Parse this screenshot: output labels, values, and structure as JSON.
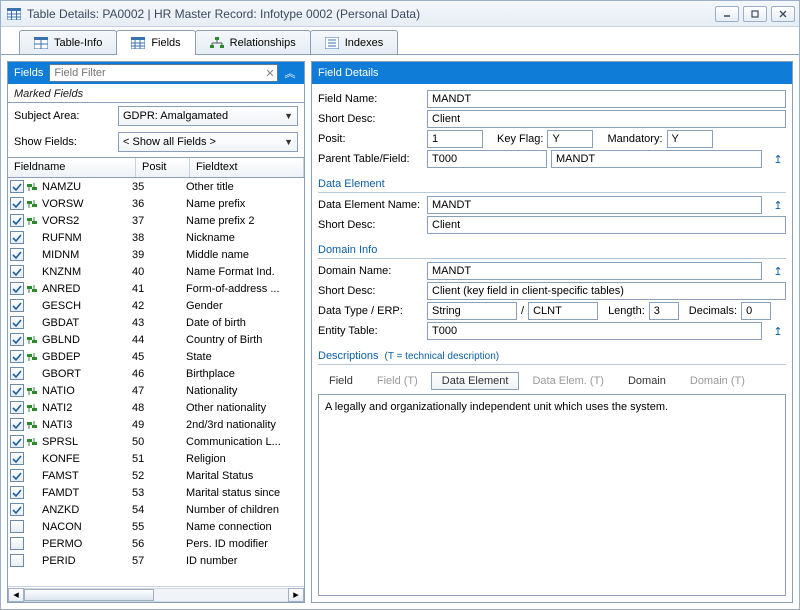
{
  "window": {
    "title": "Table Details: PA0002 | HR Master Record: Infotype 0002 (Personal Data)"
  },
  "tabs": [
    {
      "label": "Table-Info"
    },
    {
      "label": "Fields"
    },
    {
      "label": "Relationships"
    },
    {
      "label": "Indexes"
    }
  ],
  "left": {
    "header_label": "Fields",
    "filter_placeholder": "Field Filter",
    "marked_fields_label": "Marked Fields",
    "subject_area_label": "Subject Area:",
    "subject_area_value": "GDPR: Amalgamated",
    "show_fields_label": "Show Fields:",
    "show_fields_value": "< Show all Fields >",
    "columns": {
      "fieldname": "Fieldname",
      "posit": "Posit",
      "fieldtext": "Fieldtext"
    },
    "rows": [
      {
        "c": true,
        "m": true,
        "fn": "NAMZU",
        "ps": "35",
        "ft": "Other title"
      },
      {
        "c": true,
        "m": true,
        "fn": "VORSW",
        "ps": "36",
        "ft": "Name prefix"
      },
      {
        "c": true,
        "m": true,
        "fn": "VORS2",
        "ps": "37",
        "ft": "Name prefix 2"
      },
      {
        "c": true,
        "m": false,
        "fn": "RUFNM",
        "ps": "38",
        "ft": "Nickname"
      },
      {
        "c": true,
        "m": false,
        "fn": "MIDNM",
        "ps": "39",
        "ft": "Middle name"
      },
      {
        "c": true,
        "m": false,
        "fn": "KNZNM",
        "ps": "40",
        "ft": "Name Format Ind."
      },
      {
        "c": true,
        "m": true,
        "fn": "ANRED",
        "ps": "41",
        "ft": "Form-of-address ..."
      },
      {
        "c": true,
        "m": false,
        "fn": "GESCH",
        "ps": "42",
        "ft": "Gender"
      },
      {
        "c": true,
        "m": false,
        "fn": "GBDAT",
        "ps": "43",
        "ft": "Date of birth"
      },
      {
        "c": true,
        "m": true,
        "fn": "GBLND",
        "ps": "44",
        "ft": "Country of Birth"
      },
      {
        "c": true,
        "m": true,
        "fn": "GBDEP",
        "ps": "45",
        "ft": "State"
      },
      {
        "c": true,
        "m": false,
        "fn": "GBORT",
        "ps": "46",
        "ft": "Birthplace"
      },
      {
        "c": true,
        "m": true,
        "fn": "NATIO",
        "ps": "47",
        "ft": "Nationality"
      },
      {
        "c": true,
        "m": true,
        "fn": "NATI2",
        "ps": "48",
        "ft": "Other nationality"
      },
      {
        "c": true,
        "m": true,
        "fn": "NATI3",
        "ps": "49",
        "ft": "2nd/3rd nationality"
      },
      {
        "c": true,
        "m": true,
        "fn": "SPRSL",
        "ps": "50",
        "ft": "Communication L..."
      },
      {
        "c": true,
        "m": false,
        "fn": "KONFE",
        "ps": "51",
        "ft": "Religion"
      },
      {
        "c": true,
        "m": false,
        "fn": "FAMST",
        "ps": "52",
        "ft": "Marital Status"
      },
      {
        "c": true,
        "m": false,
        "fn": "FAMDT",
        "ps": "53",
        "ft": "Marital status since"
      },
      {
        "c": true,
        "m": false,
        "fn": "ANZKD",
        "ps": "54",
        "ft": "Number of children"
      },
      {
        "c": false,
        "m": false,
        "fn": "NACON",
        "ps": "55",
        "ft": "Name connection"
      },
      {
        "c": false,
        "m": false,
        "fn": "PERMO",
        "ps": "56",
        "ft": "Pers. ID modifier"
      },
      {
        "c": false,
        "m": false,
        "fn": "PERID",
        "ps": "57",
        "ft": "ID number"
      }
    ]
  },
  "right": {
    "header": "Field Details",
    "field_name_label": "Field Name:",
    "field_name": "MANDT",
    "short_desc_label": "Short Desc:",
    "short_desc": "Client",
    "posit_label": "Posit:",
    "posit": "1",
    "key_flag_label": "Key Flag:",
    "key_flag": "Y",
    "mandatory_label": "Mandatory:",
    "mandatory": "Y",
    "parent_label": "Parent Table/Field:",
    "parent_table": "T000",
    "parent_field": "MANDT",
    "de_legend": "Data Element",
    "de_name_label": "Data Element Name:",
    "de_name": "MANDT",
    "de_short_label": "Short Desc:",
    "de_short": "Client",
    "dom_legend": "Domain Info",
    "dom_name_label": "Domain Name:",
    "dom_name": "MANDT",
    "dom_short_label": "Short Desc:",
    "dom_short": "Client (key field in client-specific tables)",
    "dtype_label": "Data Type / ERP:",
    "dtype": "String",
    "slash": "/",
    "erp": "CLNT",
    "length_label": "Length:",
    "length": "3",
    "decimals_label": "Decimals:",
    "decimals": "0",
    "entity_label": "Entity Table:",
    "entity": "T000",
    "desc_legend": "Descriptions",
    "desc_sub": "(T = technical description)",
    "desc_tabs": [
      "Field",
      "Field (T)",
      "Data Element",
      "Data Elem. (T)",
      "Domain",
      "Domain (T)"
    ],
    "desc_text": "A legally and organizationally independent unit which uses the system."
  }
}
